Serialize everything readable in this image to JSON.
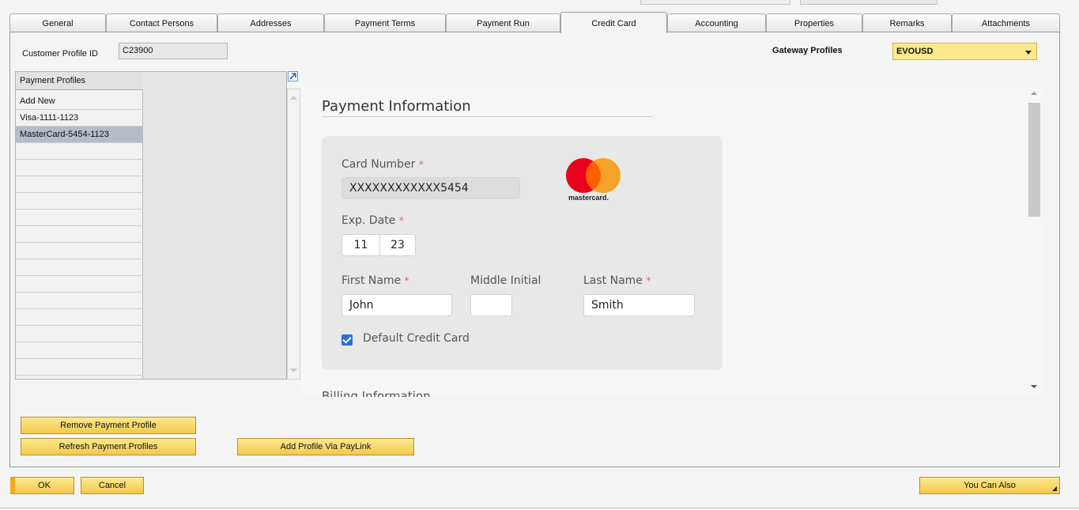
{
  "tabs": [
    {
      "label": "General"
    },
    {
      "label": "Contact Persons"
    },
    {
      "label": "Addresses"
    },
    {
      "label": "Payment Terms"
    },
    {
      "label": "Payment Run"
    },
    {
      "label": "Credit Card"
    },
    {
      "label": "Accounting"
    },
    {
      "label": "Properties"
    },
    {
      "label": "Remarks"
    },
    {
      "label": "Attachments"
    }
  ],
  "customer_profile": {
    "label": "Customer Profile ID",
    "value": "C23900"
  },
  "gateway": {
    "label": "Gateway Profiles",
    "value": "EVOUSD"
  },
  "payment_profiles": {
    "header": "Payment Profiles",
    "rows": [
      "Add New",
      "Visa-1111-1123",
      "MasterCard-5454-1123"
    ]
  },
  "payment_info": {
    "title": "Payment Information",
    "card_number_label": "Card Number",
    "card_number": "XXXXXXXXXXXX5454",
    "card_brand": "mastercard.",
    "exp_label": "Exp. Date",
    "exp_month": "11",
    "exp_year": "23",
    "first_name_label": "First Name",
    "first_name": "John",
    "middle_label": "Middle Initial",
    "middle": "",
    "last_name_label": "Last Name",
    "last_name": "Smith",
    "default_label": "Default Credit Card",
    "required_mark": "*",
    "next_section": "Billing Information"
  },
  "buttons": {
    "remove": "Remove Payment Profile",
    "refresh": "Refresh Payment Profiles",
    "paylink": "Add Profile Via PayLink",
    "ok": "OK",
    "cancel": "Cancel",
    "you_can_also": "You Can Also"
  },
  "colors": {
    "accent": "#f2c94c",
    "mc_red": "#eb001b",
    "mc_orange": "#f79e1b"
  }
}
